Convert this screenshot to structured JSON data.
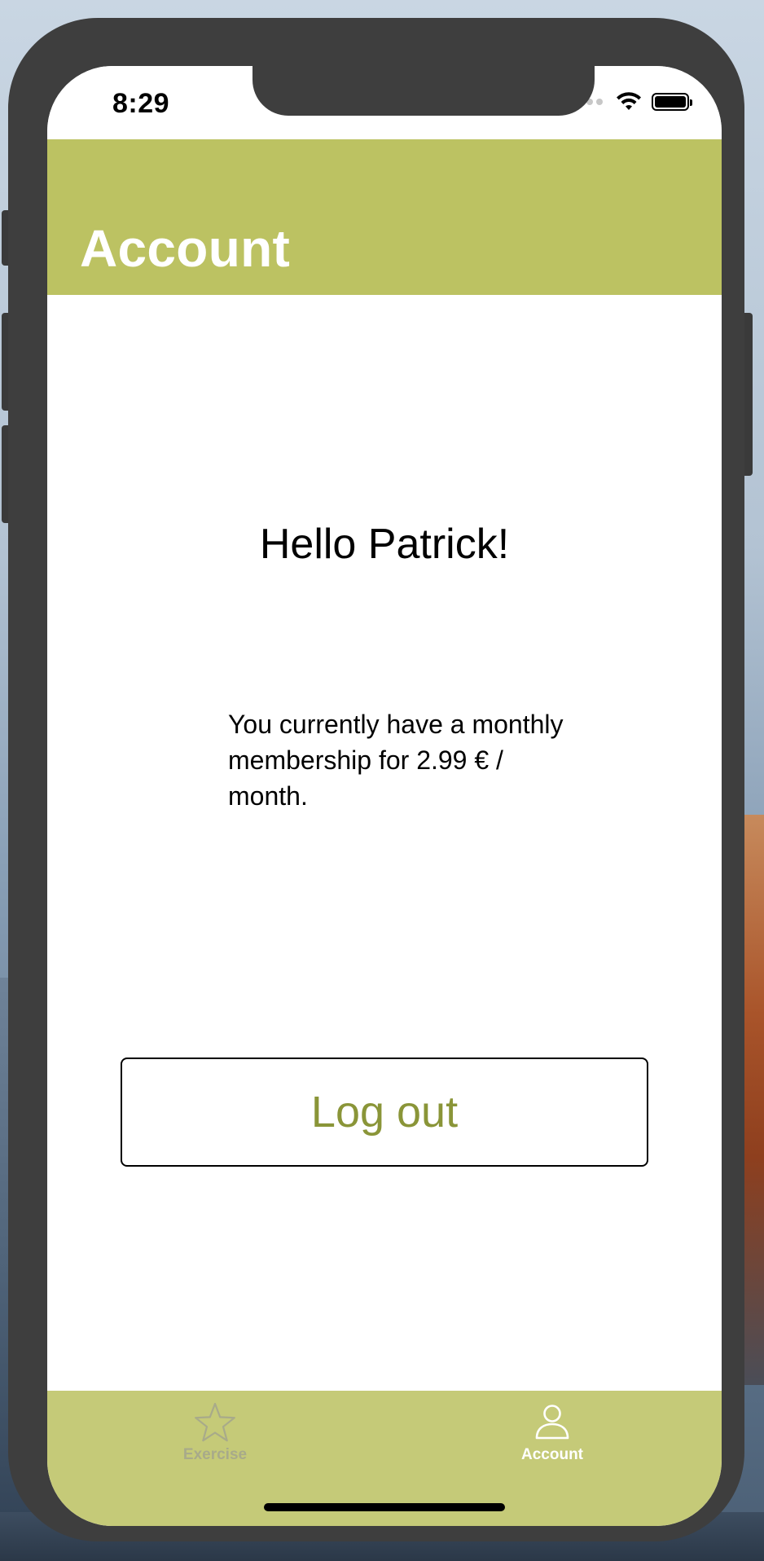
{
  "status_bar": {
    "time": "8:29"
  },
  "nav": {
    "title": "Account"
  },
  "content": {
    "greeting": "Hello Patrick!",
    "membership_text": "You currently have a monthly membership for 2.99 € / month.",
    "logout_label": "Log out"
  },
  "tabs": [
    {
      "label": "Exercise",
      "icon": "star-icon",
      "selected": false
    },
    {
      "label": "Account",
      "icon": "person-icon",
      "selected": true
    }
  ],
  "colors": {
    "nav_background": "#bcc262",
    "tab_bar_background": "#c5ca78",
    "accent_text": "#8a9538",
    "inactive_tab": "#a8aa8a",
    "active_tab": "#ffffff"
  }
}
